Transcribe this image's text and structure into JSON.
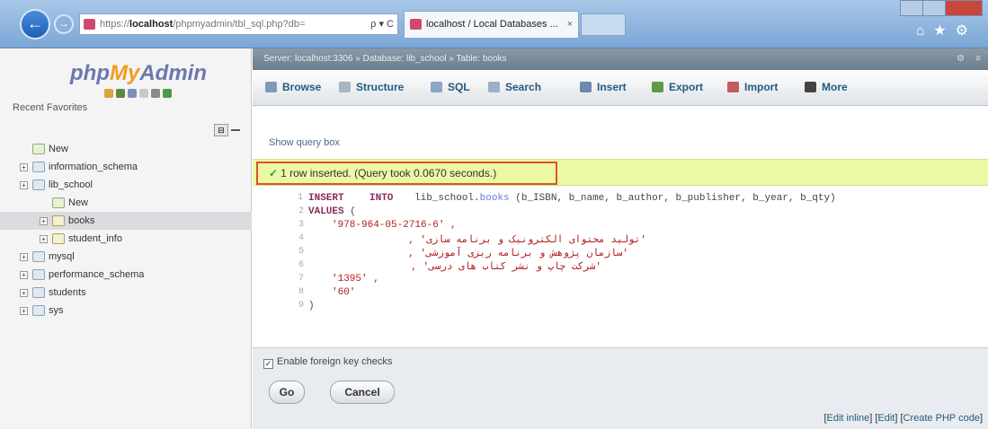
{
  "browser": {
    "address_prefix": "https://",
    "address_host": "localhost",
    "address_rest": "/phpmyadmin/tbl_sql.php?db=",
    "address_controls": "ρ ▾ C",
    "tab_title": "localhost / Local Databases ...",
    "tab_close": "×"
  },
  "sidebar": {
    "logo": {
      "php": "php",
      "my": "My",
      "admin": "Admin"
    },
    "recent": "Recent",
    "favorites": "Favorites",
    "tree": [
      {
        "label": "New",
        "level": 0,
        "type": "new"
      },
      {
        "label": "information_schema",
        "level": 0,
        "type": "db"
      },
      {
        "label": "lib_school",
        "level": 0,
        "type": "db"
      },
      {
        "label": "New",
        "level": 1,
        "type": "new"
      },
      {
        "label": "books",
        "level": 1,
        "type": "table",
        "selected": true
      },
      {
        "label": "student_info",
        "level": 1,
        "type": "table"
      },
      {
        "label": "mysql",
        "level": 0,
        "type": "db"
      },
      {
        "label": "performance_schema",
        "level": 0,
        "type": "db"
      },
      {
        "label": "students",
        "level": 0,
        "type": "db"
      },
      {
        "label": "sys",
        "level": 0,
        "type": "db"
      }
    ]
  },
  "breadcrumb": "Server: localhost:3306 » Database: lib_school » Table: books",
  "tabs": [
    {
      "label": "Browse",
      "icon": "browse-icon",
      "color": "#7d9bb8"
    },
    {
      "label": "Structure",
      "icon": "structure-icon",
      "color": "#a8b6c4"
    },
    {
      "label": "SQL",
      "icon": "sql-icon",
      "color": "#8aa6c2"
    },
    {
      "label": "Search",
      "icon": "search-icon",
      "color": "#9bb0c6"
    },
    {
      "label": "Insert",
      "icon": "insert-icon",
      "color": "#6a8ab0"
    },
    {
      "label": "Export",
      "icon": "export-icon",
      "color": "#5e9a4a"
    },
    {
      "label": "Import",
      "icon": "import-icon",
      "color": "#c45a5a"
    },
    {
      "label": "More",
      "icon": "more-icon",
      "color": "#444444"
    }
  ],
  "show_query_box": "Show query box",
  "success_message": "1 row inserted. (Query took 0.0670 seconds.)",
  "sql": {
    "line1_kw": "INSERT",
    "line1_kw2": "INTO",
    "line1_table": "lib_school.",
    "line1_table2": "books",
    "line1_cols": "(b_ISBN, b_name, b_author, b_publisher, b_year, b_qty)",
    "line2_kw": "VALUES",
    "line2_rest": "(",
    "v1": "'978-964-05-2716-6' ,",
    "v2": "'تولید محتوای الکترونیک و برنامه سازی' ,",
    "v3": "'سازمان پژوهش و برنامه ریزی آموزشی' ,",
    "v4": "'شرکت چاپ و نشر کتاب های درسی' ,",
    "v5": "'1395' ,",
    "v6": "'60'",
    "close": ")"
  },
  "fk_label": "Enable foreign key checks",
  "go_label": "Go",
  "cancel_label": "Cancel",
  "links": [
    "Edit inline",
    "Edit",
    "Create PHP code"
  ]
}
